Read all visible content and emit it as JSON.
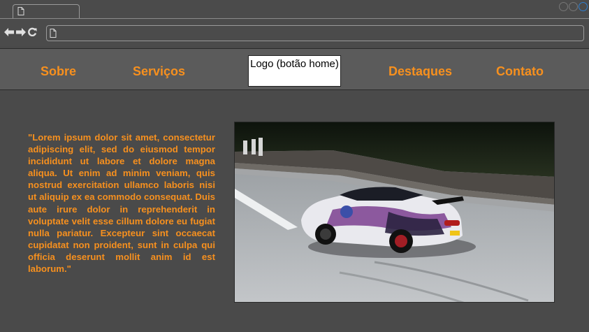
{
  "browser": {
    "tab_icon": "document-icon",
    "address_icon": "document-icon",
    "nav_icons": [
      "back-arrow-icon",
      "forward-arrow-icon",
      "reload-icon"
    ],
    "accent_color": "#2f7fd1"
  },
  "header": {
    "nav_left": [
      "Sobre",
      "Serviços"
    ],
    "logo_label": "Logo (botão home)",
    "nav_right": [
      "Destaques",
      "Contato"
    ],
    "nav_color": "#f7901e"
  },
  "main": {
    "intro_text": "\"Lorem ipsum dolor sit amet, consectetur adipiscing elit, sed do eiusmod tempor incididunt ut labore et dolore magna aliqua. Ut enim ad minim veniam, quis nostrud exercitation ullamco laboris nisi ut aliquip ex ea commodo consequat. Duis aute irure dolor in reprehenderit in voluptate velit esse cillum dolore eu fugiat nulla pariatur. Excepteur sint occaecat cupidatat non proident, sunt in culpa qui officia deserunt mollit anim id est laborum.\"",
    "hero_image": "drifting-car-photo"
  }
}
